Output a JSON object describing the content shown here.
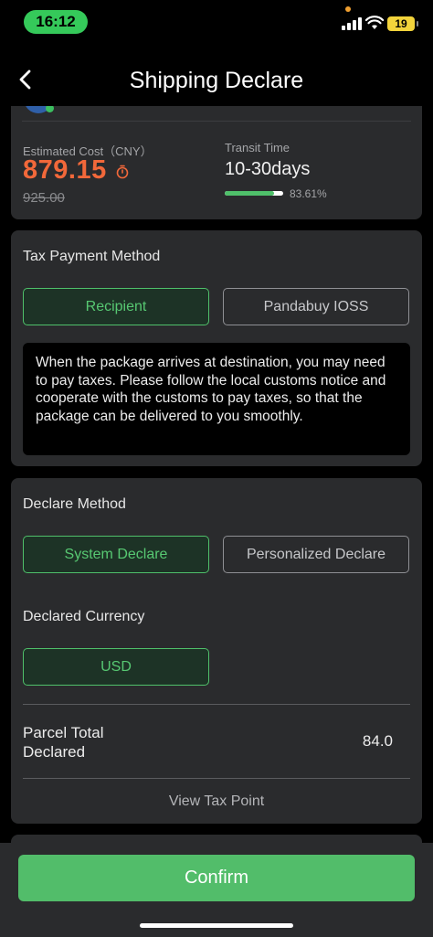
{
  "status_bar": {
    "time": "16:12",
    "battery": "19"
  },
  "nav": {
    "title": "Shipping Declare"
  },
  "cost": {
    "label": "Estimated Cost（CNY）",
    "value": "879.15",
    "original_value": "925.00",
    "transit_label": "Transit Time",
    "transit_value": "10-30days",
    "progress_text": "83.61%",
    "progress_fraction": 0.8361
  },
  "tax": {
    "title": "Tax Payment Method",
    "options": [
      "Recipient",
      "Pandabuy IOSS"
    ],
    "selected": "Recipient",
    "notice": "When the package arrives at destination, you may need to pay taxes. Please follow the local customs notice and cooperate with the customs to pay taxes, so that the package can be delivered to you smoothly."
  },
  "declare": {
    "title": "Declare Method",
    "options": [
      "System Declare",
      "Personalized Declare"
    ],
    "selected": "System Declare",
    "currency_title": "Declared Currency",
    "currency": "USD",
    "parcel_label": "Parcel Total Declared",
    "parcel_value": "84.0",
    "tax_point_link": "View Tax Point"
  },
  "footer": {
    "confirm_label": "Confirm"
  },
  "colors": {
    "accent": "#52bd6a",
    "price": "#f2683a",
    "background": "#000000",
    "card": "#2a2b2d"
  },
  "icons": [
    "back-arrow-icon",
    "timer-icon",
    "globe-icon",
    "wifi-icon",
    "signal-icon",
    "battery-icon"
  ]
}
